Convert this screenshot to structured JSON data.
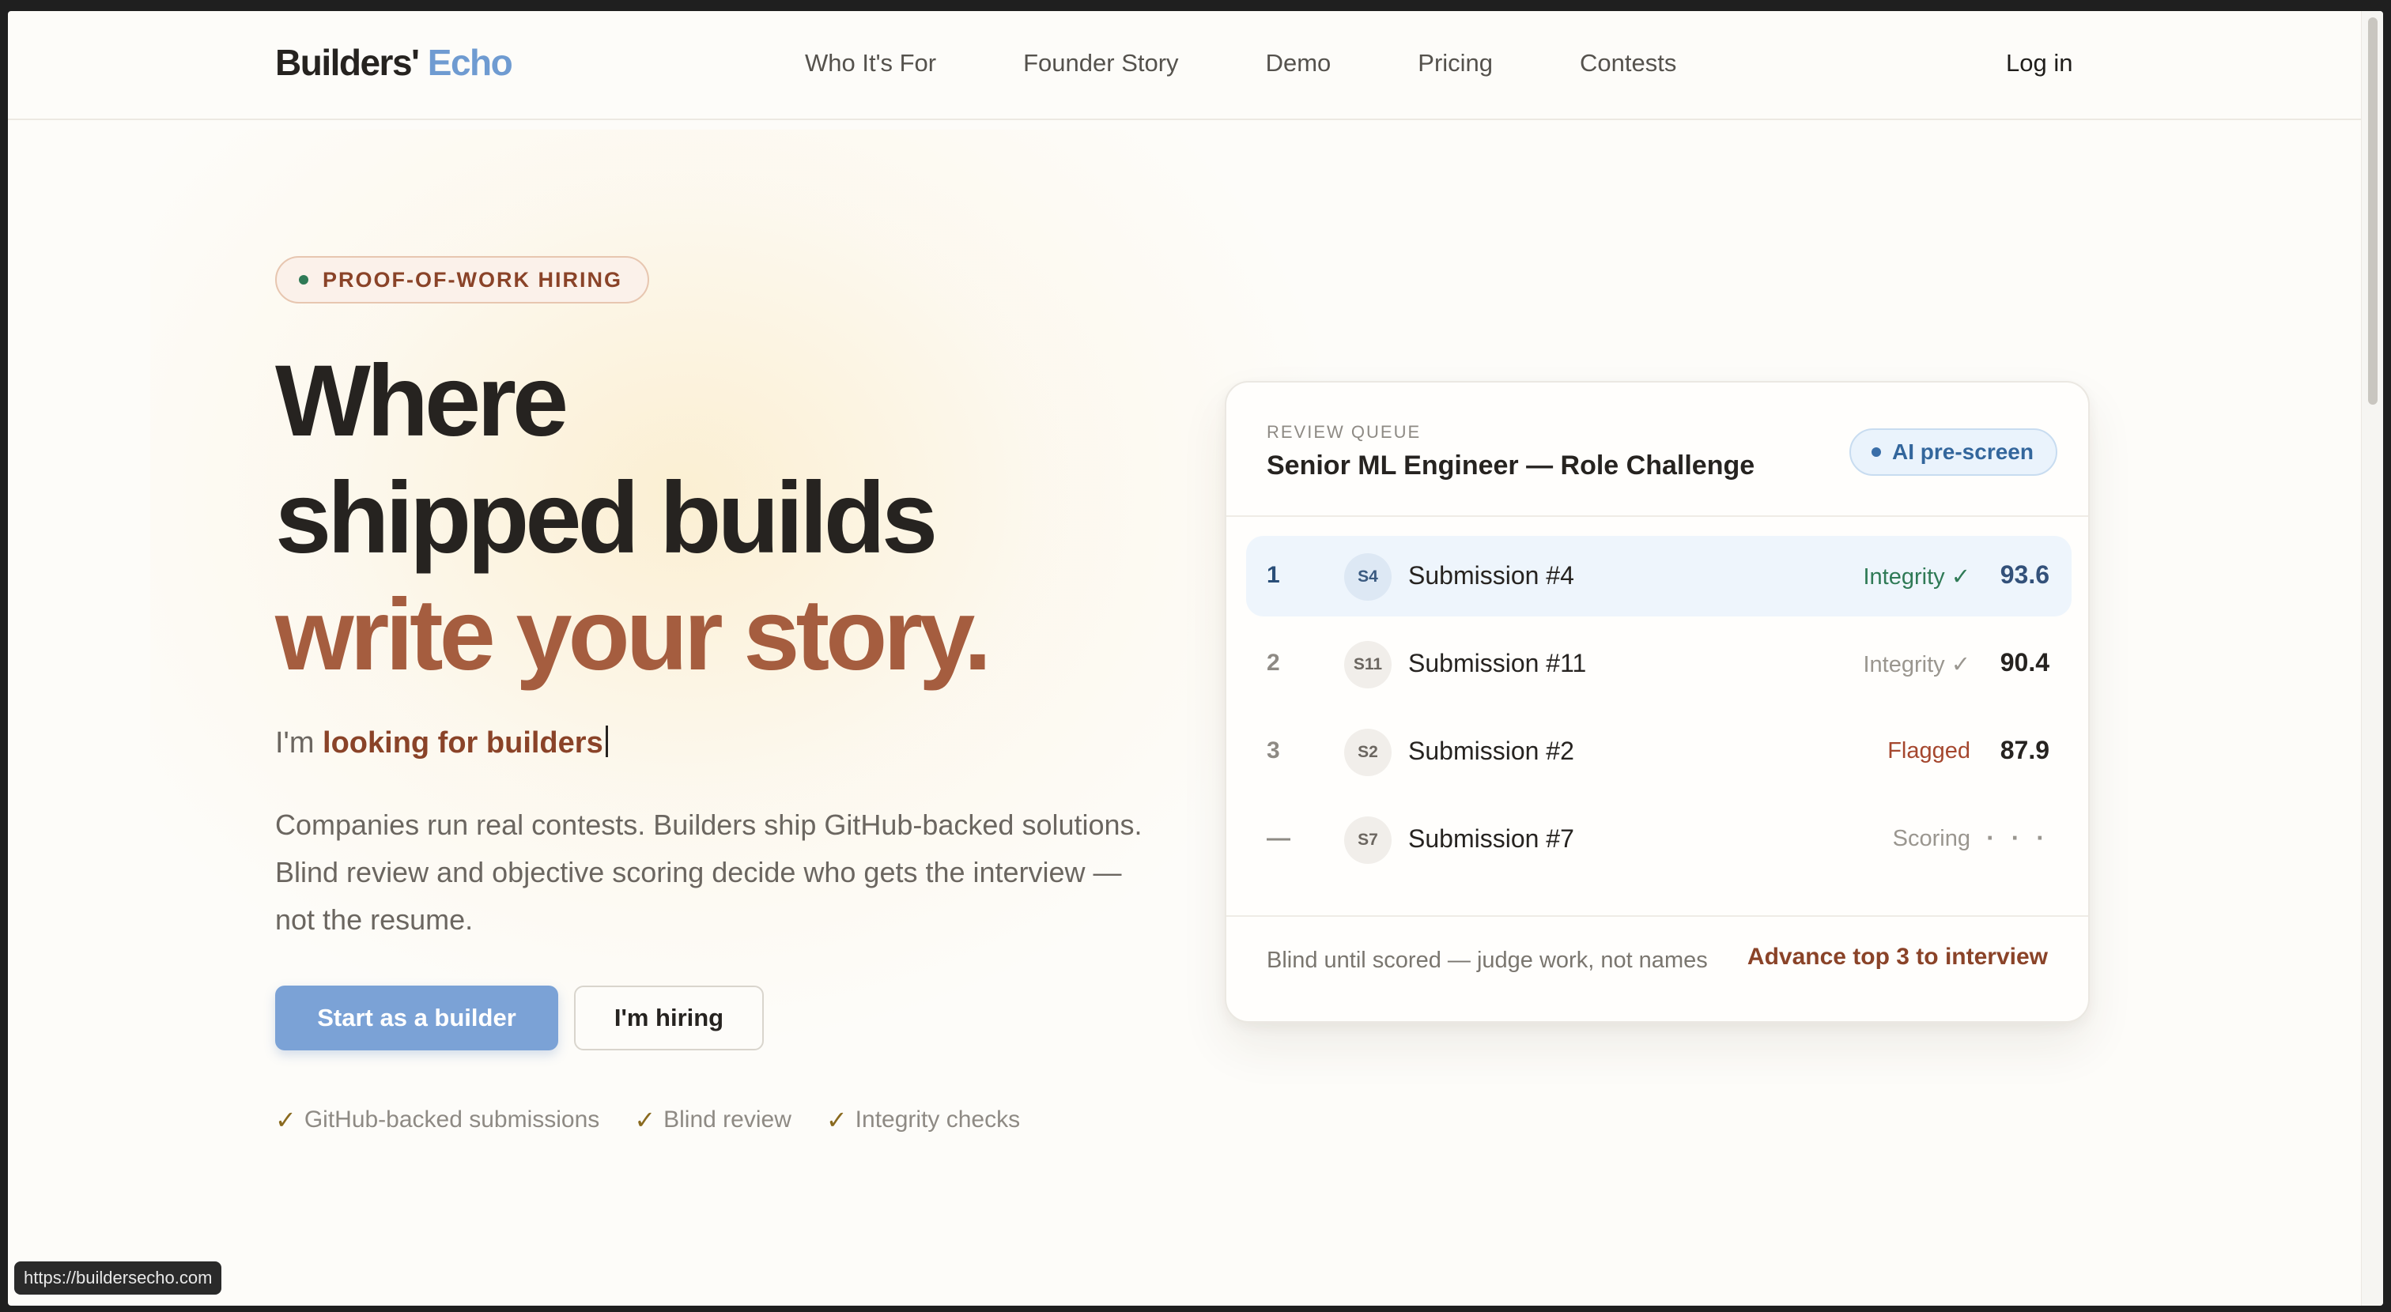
{
  "nav": {
    "logo_main": "Builders'",
    "logo_accent": "Echo",
    "links": [
      "Who It's For",
      "Founder Story",
      "Demo",
      "Pricing",
      "Contests"
    ],
    "login": "Log in"
  },
  "hero": {
    "pill": "PROOF-OF-WORK HIRING",
    "headline_1": "Where",
    "headline_2": "shipped builds",
    "headline_3": "write your story.",
    "typed_prefix": "I'm",
    "typed_value": "looking for builders",
    "description": "Companies run real contests. Builders ship GitHub-backed solutions. Blind review and objective scoring decide who gets the interview — not the resume.",
    "primary_button": "Start as a builder",
    "secondary_button": "I'm hiring",
    "checks": [
      "GitHub-backed submissions",
      "Blind review",
      "Integrity checks"
    ],
    "check_glyph": "✓"
  },
  "card": {
    "kicker": "REVIEW QUEUE",
    "title": "Senior ML Engineer — Role Challenge",
    "badge": "AI pre-screen",
    "rows": [
      {
        "rank": "1",
        "avatar": "S4",
        "name": "Submission #4",
        "status": "Integrity ✓",
        "score": "93.6"
      },
      {
        "rank": "2",
        "avatar": "S11",
        "name": "Submission #11",
        "status": "Integrity ✓",
        "score": "90.4"
      },
      {
        "rank": "3",
        "avatar": "S2",
        "name": "Submission #2",
        "status": "Flagged",
        "score": "87.9"
      },
      {
        "rank": "—",
        "avatar": "S7",
        "name": "Submission #7",
        "status": "Scoring",
        "score": "· · ·"
      }
    ],
    "footer_note": "Blind until scored — judge work, not names",
    "footer_link": "Advance top 3 to interview"
  },
  "status_url": "https://buildersecho.com",
  "colors": {
    "accent_blue": "#7ba2d6",
    "accent_orange": "#a55d3f",
    "text_dark": "#262320",
    "success": "#2f7a56",
    "danger": "#a5472e"
  }
}
